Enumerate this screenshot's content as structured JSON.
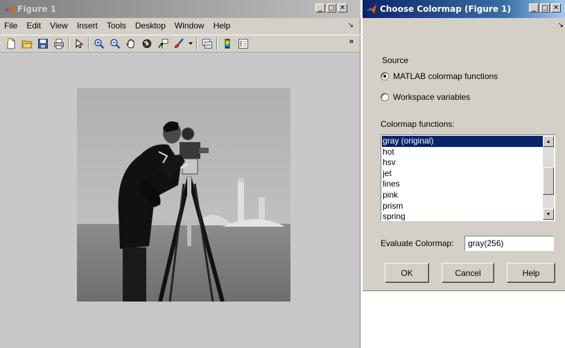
{
  "figure": {
    "title": "Figure 1",
    "window_buttons": {
      "minimize": "_",
      "maximize": "□",
      "close": "✕"
    },
    "menu": [
      "File",
      "Edit",
      "View",
      "Insert",
      "Tools",
      "Desktop",
      "Window",
      "Help"
    ],
    "menu_overflow": "↘",
    "toolbar_overflow": "»",
    "toolbar_icons": [
      "new-figure-icon",
      "open-file-icon",
      "save-icon",
      "print-icon",
      "pointer-icon",
      "zoom-in-icon",
      "zoom-out-icon",
      "pan-icon",
      "rotate-3d-icon",
      "data-cursor-icon",
      "brush-icon",
      "link-plot-icon",
      "colorbar-icon",
      "legend-icon"
    ]
  },
  "dialog": {
    "title": "Choose Colormap (Figure 1)",
    "window_buttons": {
      "minimize": "_",
      "maximize": "□",
      "close": "✕"
    },
    "strip_arrow": "↘",
    "source_label": "Source",
    "radio_options": [
      {
        "label": "MATLAB colormap functions",
        "selected": true
      },
      {
        "label": "Workspace variables",
        "selected": false
      }
    ],
    "functions_label": "Colormap functions:",
    "functions": [
      "gray (original)",
      "hot",
      "hsv",
      "jet",
      "lines",
      "pink",
      "prism",
      "spring"
    ],
    "selected_function": "gray (original)",
    "evaluate_label": "Evaluate Colormap:",
    "evaluate_value": "gray(256)",
    "buttons": {
      "ok": "OK",
      "cancel": "Cancel",
      "help": "Help"
    },
    "scroll_up": "▲",
    "scroll_down": "▼"
  },
  "colors": {
    "window_bg": "#d4d0c8",
    "figure_canvas": "#c8c8c8",
    "active_title": "#0a246a",
    "inactive_title": "#808080",
    "list_selection": "#0a246a"
  }
}
